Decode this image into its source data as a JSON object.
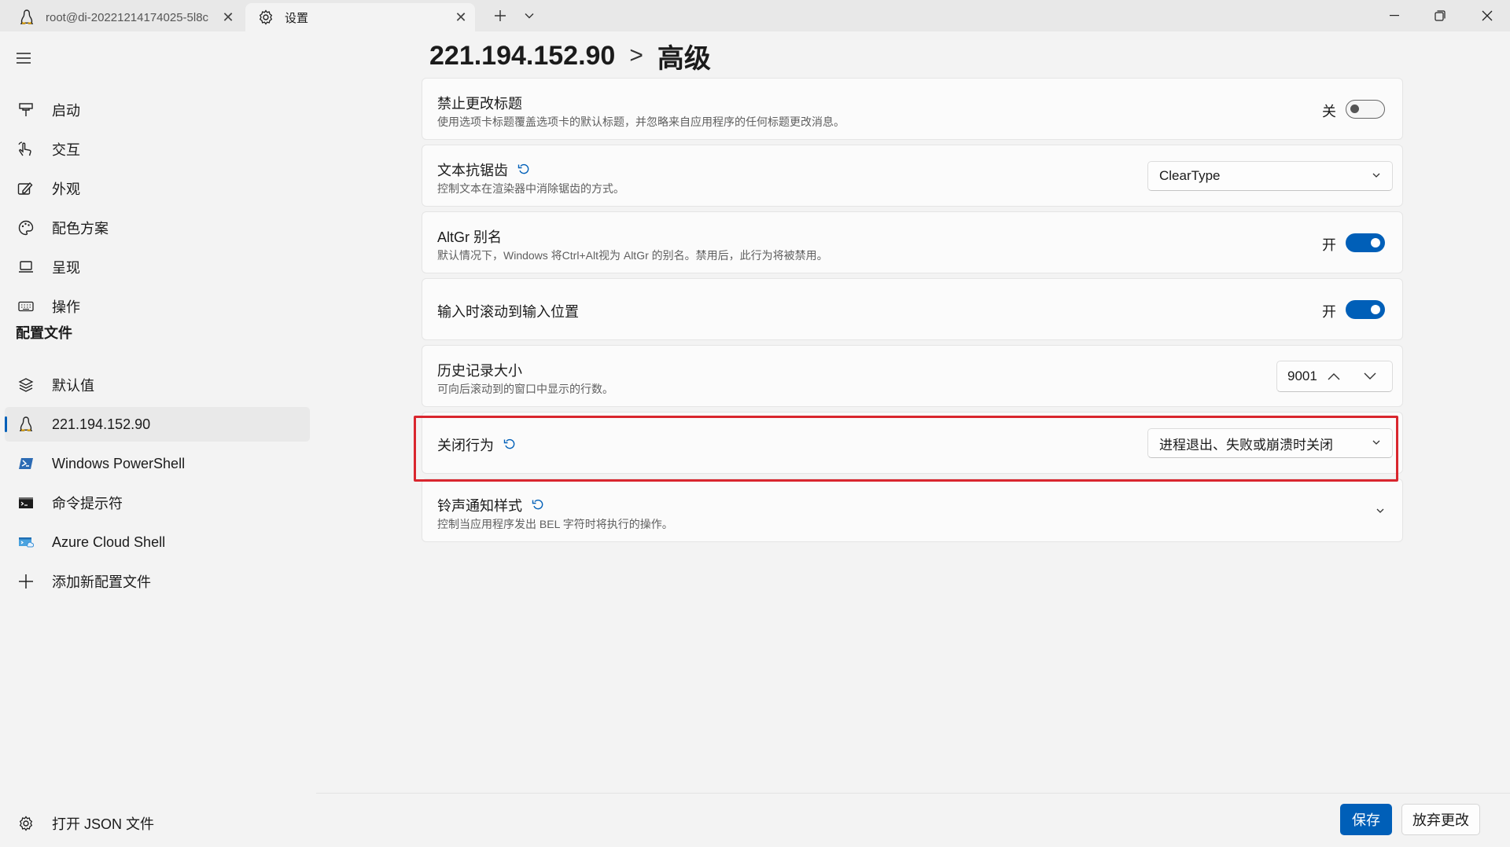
{
  "tabs": [
    {
      "title": "root@di-20221214174025-5l8c",
      "icon": "linux-tux-icon"
    },
    {
      "title": "设置",
      "icon": "gear-icon"
    }
  ],
  "sidebar": {
    "items": [
      {
        "label": "启动",
        "icon": "startup-icon"
      },
      {
        "label": "交互",
        "icon": "interaction-icon"
      },
      {
        "label": "外观",
        "icon": "appearance-icon"
      },
      {
        "label": "配色方案",
        "icon": "palette-icon"
      },
      {
        "label": "呈现",
        "icon": "rendering-icon"
      },
      {
        "label": "操作",
        "icon": "keyboard-icon"
      }
    ],
    "profiles_header": "配置文件",
    "profiles": [
      {
        "label": "默认值",
        "icon": "layers-icon"
      },
      {
        "label": "221.194.152.90",
        "icon": "linux-tux-icon",
        "selected": true
      },
      {
        "label": "Windows PowerShell",
        "icon": "powershell-icon"
      },
      {
        "label": "命令提示符",
        "icon": "cmd-icon"
      },
      {
        "label": "Azure Cloud Shell",
        "icon": "azure-icon"
      },
      {
        "label": "添加新配置文件",
        "icon": "plus-icon"
      }
    ],
    "open_json": "打开 JSON 文件"
  },
  "breadcrumb": {
    "parent": "221.194.152.90",
    "separator": ">",
    "current": "高级"
  },
  "settings": {
    "suppress_title": {
      "title": "禁止更改标题",
      "desc": "使用选项卡标题覆盖选项卡的默认标题，并忽略来自应用程序的任何标题更改消息。",
      "state_label": "关",
      "value": false
    },
    "antialiasing": {
      "title": "文本抗锯齿",
      "desc": "控制文本在渲染器中消除锯齿的方式。",
      "value": "ClearType"
    },
    "altgr": {
      "title": "AltGr 别名",
      "desc": "默认情况下，Windows 将Ctrl+Alt视为 AltGr 的别名。禁用后，此行为将被禁用。",
      "state_label": "开",
      "value": true
    },
    "scroll_on_input": {
      "title": "输入时滚动到输入位置",
      "state_label": "开",
      "value": true
    },
    "history_size": {
      "title": "历史记录大小",
      "desc": "可向后滚动到的窗口中显示的行数。",
      "value": "9001"
    },
    "close_behavior": {
      "title": "关闭行为",
      "value": "进程退出、失败或崩溃时关闭"
    },
    "bell_style": {
      "title": "铃声通知样式",
      "desc": "控制当应用程序发出 BEL 字符时将执行的操作。"
    }
  },
  "footer": {
    "save": "保存",
    "discard": "放弃更改"
  },
  "colors": {
    "accent": "#005fb8",
    "highlight": "#d9262e"
  }
}
